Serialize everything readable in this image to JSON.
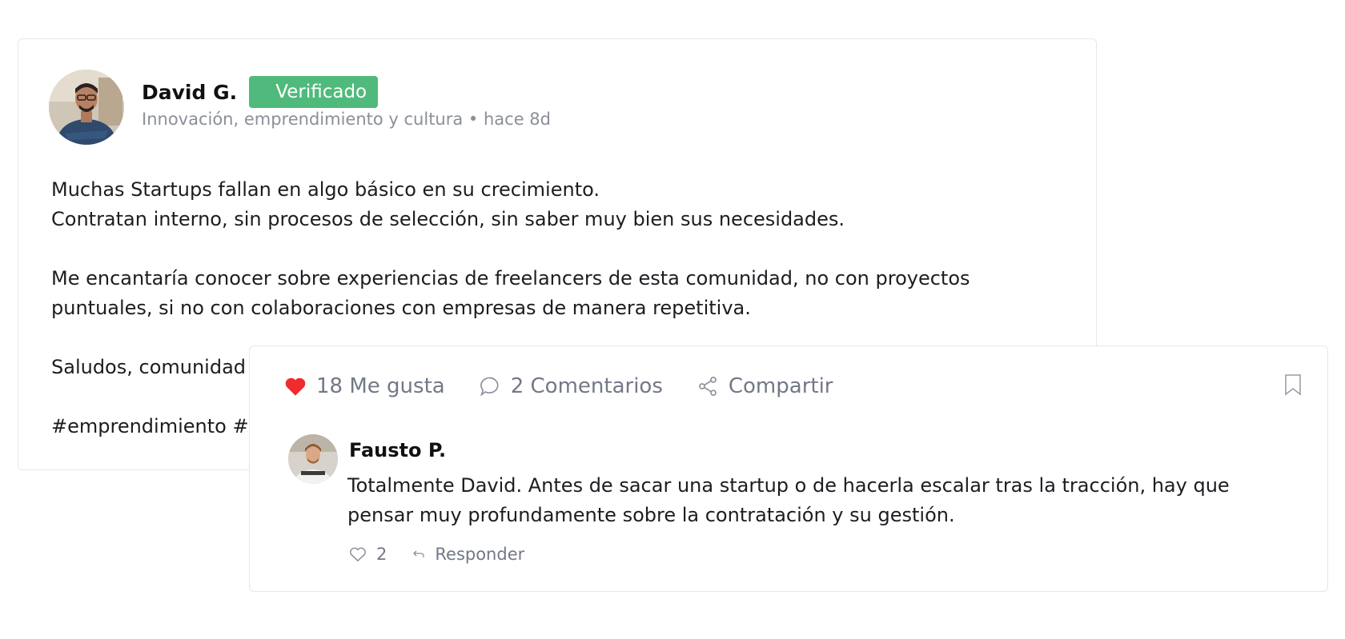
{
  "post": {
    "author": "David G.",
    "badge": "Verificado",
    "meta": "Innovación, emprendimiento y cultura • hace 8d",
    "paragraphs": [
      "Muchas Startups fallan en algo básico en su crecimiento.",
      "Contratan interno, sin procesos de selección, sin saber muy bien sus necesidades.",
      "",
      "Me encantaría conocer sobre experiencias de freelancers de esta comunidad, no con proyectos",
      "puntuales, si no con colaboraciones con empresas de manera repetitiva.",
      "",
      "Saludos, comunidad",
      "",
      "#emprendimiento #"
    ]
  },
  "actions": {
    "likes": "18 Me gusta",
    "comments": "2 Comentarios",
    "share": "Compartir"
  },
  "comment": {
    "author": "Fausto P.",
    "text_line1": "Totalmente David. Antes de sacar una startup o de hacerla escalar tras la tracción, hay que",
    "text_line2": "pensar muy profundamente sobre la contratación y su gestión.",
    "likes": "2",
    "reply": "Responder"
  },
  "colors": {
    "verified": "#4fba7b",
    "heart": "#ef2b2d",
    "muted": "#737887"
  },
  "icons": [
    "heart-icon",
    "comment-icon",
    "share-icon",
    "bookmark-icon",
    "heart-outline-icon",
    "reply-icon"
  ]
}
